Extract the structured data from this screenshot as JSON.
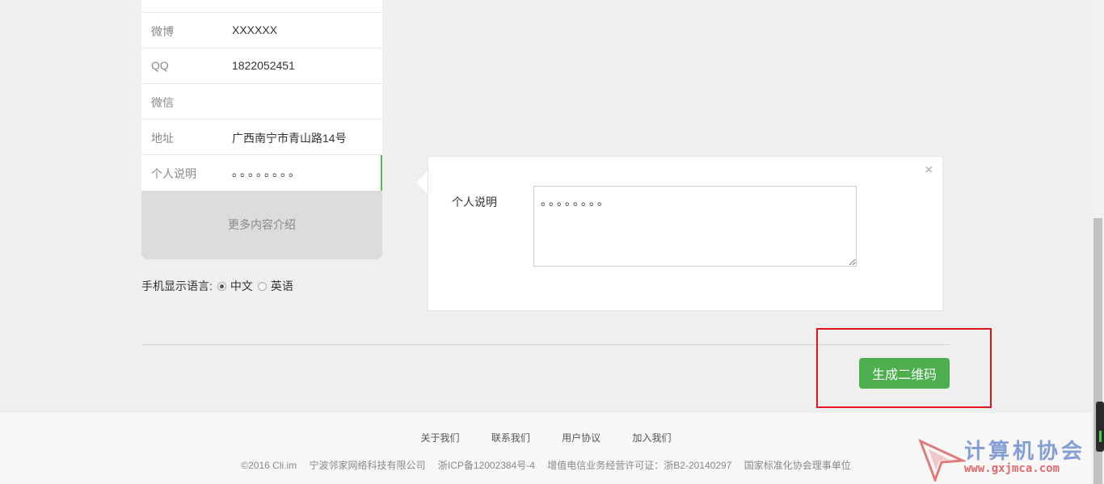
{
  "form": {
    "rows": [
      {
        "label": "微博",
        "value": "XXXXXX"
      },
      {
        "label": "QQ",
        "value": "1822052451"
      },
      {
        "label": "微信",
        "value": ""
      },
      {
        "label": "地址",
        "value": "广西南宁市青山路14号"
      },
      {
        "label": "个人说明",
        "value": "。。。。。。。。"
      }
    ],
    "more_label": "更多内容介绍"
  },
  "language": {
    "label": "手机显示语言:",
    "options": [
      "中文",
      "英语"
    ],
    "selected": "中文"
  },
  "popover": {
    "close": "×",
    "label": "个人说明",
    "textarea_value": "。。。。。。。。"
  },
  "generate_button": "生成二维码",
  "footer": {
    "links": [
      "关于我们",
      "联系我们",
      "用户协议",
      "加入我们"
    ],
    "info": [
      "©2016 Cli.im",
      "宁波邻家网络科技有限公司",
      "浙ICP备12002384号-4",
      "增值电信业务经营许可证：浙B2-20140297",
      "国家标准化协会理事单位"
    ]
  },
  "watermark": {
    "title": "计算机协会",
    "url": "www.gxjmca.com"
  },
  "colors": {
    "accent_green": "#4cae4c",
    "highlight_red": "#e0161f"
  }
}
